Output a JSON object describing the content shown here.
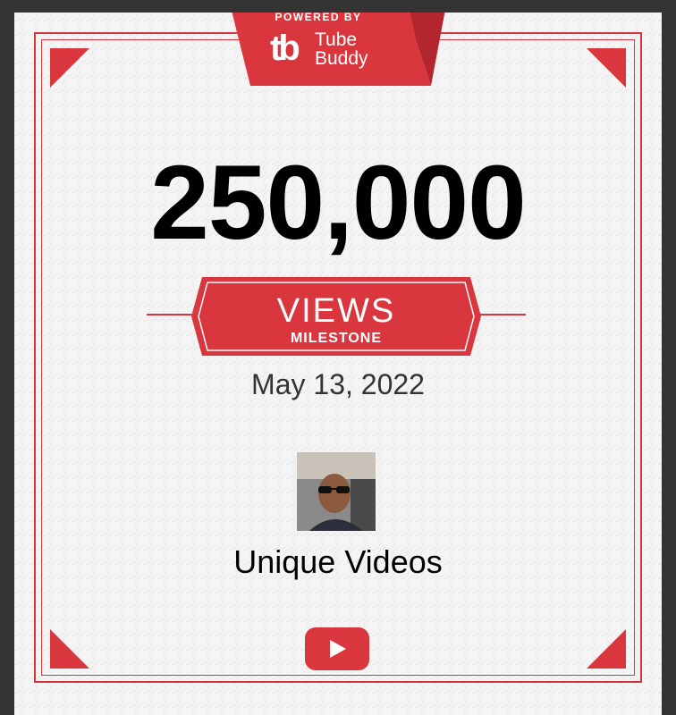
{
  "badge": {
    "powered_by": "POWERED BY",
    "brand_mark": "tb",
    "brand_line1": "Tube",
    "brand_line2": "Buddy"
  },
  "milestone": {
    "count": "250,000",
    "metric": "VIEWS",
    "label": "MILESTONE",
    "date": "May 13, 2022"
  },
  "channel": {
    "name": "Unique Videos"
  },
  "icons": {
    "footer": "youtube-play-icon",
    "avatar": "channel-avatar"
  },
  "colors": {
    "accent": "#d9363e",
    "background": "#333333",
    "card": "#f4f4f4"
  }
}
